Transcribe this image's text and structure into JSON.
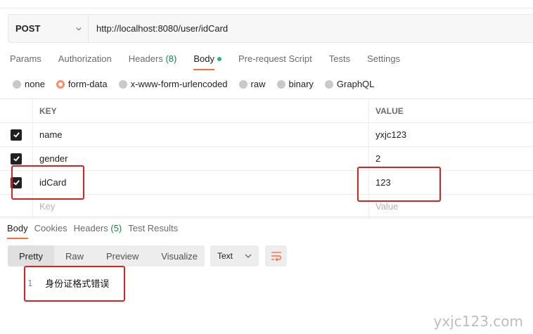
{
  "request": {
    "method": "POST",
    "url": "http://localhost:8080/user/idCard"
  },
  "tabs": [
    {
      "label": "Params"
    },
    {
      "label": "Authorization"
    },
    {
      "label": "Headers",
      "count": "(8)"
    },
    {
      "label": "Body",
      "active": true
    },
    {
      "label": "Pre-request Script"
    },
    {
      "label": "Tests"
    },
    {
      "label": "Settings"
    }
  ],
  "body_types": [
    {
      "label": "none"
    },
    {
      "label": "form-data",
      "selected": true
    },
    {
      "label": "x-www-form-urlencoded"
    },
    {
      "label": "raw"
    },
    {
      "label": "binary"
    },
    {
      "label": "GraphQL"
    }
  ],
  "table": {
    "headers": {
      "key": "KEY",
      "value": "VALUE"
    },
    "rows": [
      {
        "key": "name",
        "value": "yxjc123",
        "checked": true
      },
      {
        "key": "gender",
        "value": "2",
        "checked": true
      },
      {
        "key": "idCard",
        "value": "123",
        "checked": true
      }
    ],
    "placeholder": {
      "key": "Key",
      "value": "Value"
    }
  },
  "response": {
    "tabs": [
      {
        "label": "Body",
        "active": true
      },
      {
        "label": "Cookies"
      },
      {
        "label": "Headers",
        "count": "(5)"
      },
      {
        "label": "Test Results"
      }
    ],
    "views": [
      "Pretty",
      "Raw",
      "Preview",
      "Visualize"
    ],
    "active_view": "Pretty",
    "format": "Text",
    "lines": [
      {
        "num": "1",
        "text": "身份证格式错误"
      }
    ]
  },
  "watermark": "yxjc123.com",
  "colors": {
    "accent": "#ff6c37",
    "annotation": "#e02020",
    "count_green": "#0b8a3e"
  }
}
